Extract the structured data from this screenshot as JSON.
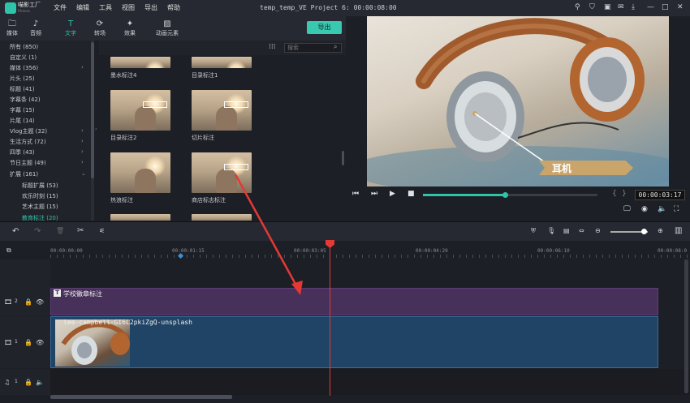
{
  "app": {
    "name": "喵影工厂",
    "sub": "Filmora",
    "title": "temp_temp_VE Project 6: 00:00:08:00"
  },
  "menu": [
    "文件",
    "编辑",
    "工具",
    "视图",
    "导出",
    "帮助"
  ],
  "window_controls": [
    "user-icon",
    "cart-icon",
    "save-icon",
    "mail-icon",
    "download-icon",
    "minimize",
    "maximize",
    "close"
  ],
  "tabs": [
    {
      "label": "媒体",
      "icon": "folder-icon"
    },
    {
      "label": "音频",
      "icon": "music-icon"
    },
    {
      "label": "文字",
      "icon": "text-icon",
      "active": true
    },
    {
      "label": "转场",
      "icon": "transition-icon"
    },
    {
      "label": "效果",
      "icon": "effects-icon"
    },
    {
      "label": "动画元素",
      "icon": "image-icon"
    }
  ],
  "export_label": "导出",
  "categories": [
    {
      "label": "所有 (850)"
    },
    {
      "label": "自定义 (1)"
    },
    {
      "label": "媒体 (356)",
      "arrow": true
    },
    {
      "label": "片头 (25)"
    },
    {
      "label": "标题 (41)"
    },
    {
      "label": "字幕条 (42)"
    },
    {
      "label": "字幕 (15)"
    },
    {
      "label": "片尾 (14)"
    },
    {
      "label": "Vlog主题 (32)",
      "arrow": true
    },
    {
      "label": "生活方式 (72)",
      "arrow": true
    },
    {
      "label": "四季 (43)",
      "arrow": true
    },
    {
      "label": "节日主题 (49)",
      "arrow": true
    },
    {
      "label": "扩展 (161)",
      "arrow": true,
      "expanded": true
    },
    {
      "label": "标题扩展 (53)",
      "sub": true
    },
    {
      "label": "欢乐时刻 (15)",
      "sub": true
    },
    {
      "label": "艺术主题 (15)",
      "sub": true
    },
    {
      "label": "教育标注 (20)",
      "sub": true,
      "highlight": true
    }
  ],
  "search": {
    "placeholder": "搜索"
  },
  "templates": [
    {
      "label": "墨水标注4"
    },
    {
      "label": "目录标注1"
    },
    {
      "label": "目录标注2"
    },
    {
      "label": "切片标注"
    },
    {
      "label": "热浪标注"
    },
    {
      "label": "商店标志标注"
    }
  ],
  "preview": {
    "caption": "耳机",
    "timecode": "00:00:03:17",
    "progress": 0.47
  },
  "ruler": [
    "00:00:00:00",
    "00:00:01:15",
    "00:00:03:05",
    "00:00:04:20",
    "00:00:06:10",
    "00:00:08:0"
  ],
  "tracks": {
    "text_track_num": "2",
    "video_track_num": "1",
    "audio_track_num": "1",
    "text_clip": "学校徽章标注",
    "video_clip": "lee-campbell-GI6L2pkiZgQ-unsplash"
  },
  "colors": {
    "accent": "#2ec4a9",
    "playhead": "#e53935",
    "text_clip": "#47305a",
    "video_clip": "#1f4466"
  }
}
